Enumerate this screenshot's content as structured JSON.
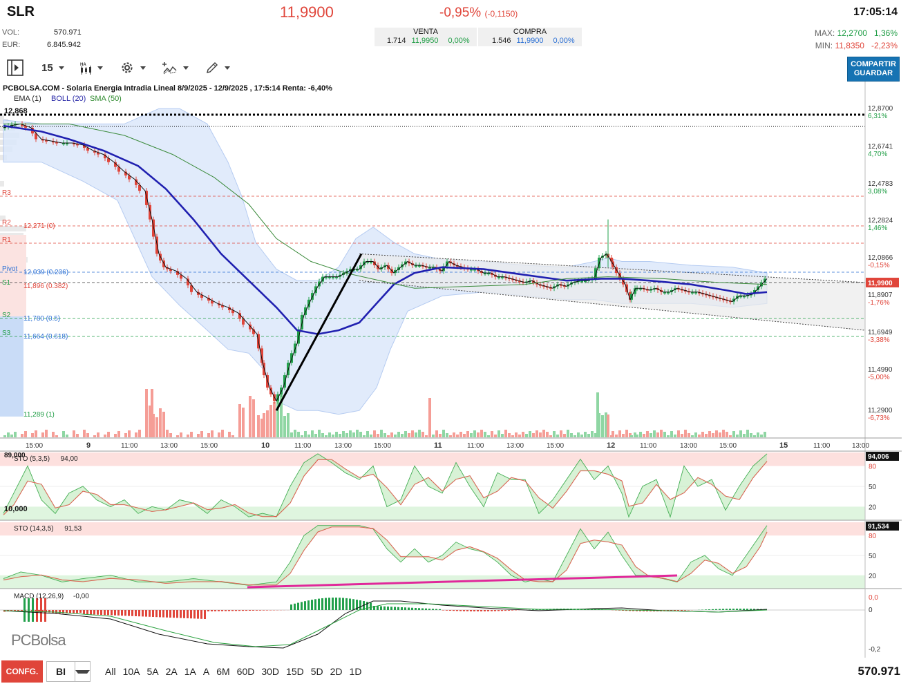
{
  "header": {
    "ticker": "SLR",
    "price": "11,9900",
    "change": "-0,95%",
    "change_abs": "(-0,1150)",
    "time": "17:05:14",
    "vol_label": "VOL:",
    "vol_value": "570.971",
    "eur_label": "EUR:",
    "eur_value": "6.845.942",
    "venta": {
      "title": "VENTA",
      "qty": "1.714",
      "price": "11,9950",
      "pct": "0,00%"
    },
    "compra": {
      "title": "COMPRA",
      "qty": "1.546",
      "price": "11,9900",
      "pct": "0,00%"
    },
    "max_label": "MAX:",
    "max_value": "12,2700",
    "max_pct": "1,36%",
    "min_label": "MIN:",
    "min_value": "11,8350",
    "min_pct": "-2,23%"
  },
  "toolbar": {
    "interval": "15",
    "candle_icon_label": "HA",
    "share_line1": "COMPARTIR",
    "share_line2": "GUARDAR"
  },
  "chart": {
    "title": "PCBOLSA.COM - Solaria Energia Intradia Lineal 8/9/2025 - 12/9/2025 , 17:5:14 Renta: -6,40%",
    "legend": {
      "ema": "EMA (1)",
      "boll": "BOLL (20)",
      "sma": "SMA (50)"
    },
    "colors": {
      "up": "#22a04b",
      "down": "#e0453a",
      "ema": "#2020b0",
      "sma": "#3a8a3a",
      "boll_fill": "#dce8fb",
      "pink": "#e0289a"
    },
    "top_label": "12,868",
    "last_price_tag": "11,9900",
    "price_axis": [
      {
        "v": "12,8700",
        "p": "6,31%"
      },
      {
        "v": "12,6741",
        "p": "4,70%"
      },
      {
        "v": "12,4783",
        "p": "3,08%"
      },
      {
        "v": "12,2824",
        "p": "1,46%"
      },
      {
        "v": "12,0866",
        "p": "-0,15%"
      },
      {
        "v": "11,8907",
        "p": "-1,76%"
      },
      {
        "v": "11,6949",
        "p": "-3,38%"
      },
      {
        "v": "11,4990",
        "p": "-5,00%"
      },
      {
        "v": "11,2900",
        "p": "-6,73%"
      }
    ],
    "pivots": [
      {
        "name": "R3",
        "val": ""
      },
      {
        "name": "R2",
        "val": "12,271 (0)"
      },
      {
        "name": "R1",
        "val": ""
      },
      {
        "name": "Pivot",
        "val": "12,039 (0.236)"
      },
      {
        "name": "S1",
        "val": "11,896 (0.382)"
      },
      {
        "name": "S2",
        "val": "11,780 (0.5)"
      },
      {
        "name": "S3",
        "val": "11,664 (0.618)"
      },
      {
        "name": "",
        "val": "11,289 (1)"
      }
    ],
    "time_axis": [
      "15:00",
      "9",
      "11:00",
      "13:00",
      "15:00",
      "10",
      "11:00",
      "13:00",
      "15:00",
      "11",
      "11:00",
      "13:00",
      "15:00",
      "12",
      "11:00",
      "13:00",
      "15:00",
      "15",
      "11:00",
      "13:00"
    ],
    "vol_max_label": "89,000",
    "vol_min_label": "10,000"
  },
  "sto1": {
    "label": "STO (5,3,5)",
    "value": "94,00",
    "tag": "94,006",
    "levels": [
      "80",
      "50",
      "20"
    ]
  },
  "sto2": {
    "label": "STO (14,3,5)",
    "value": "91,53",
    "tag": "91,534",
    "levels": [
      "80",
      "50",
      "20"
    ]
  },
  "macd": {
    "label": "MACD (12,26,9)",
    "value": "-0,00",
    "levels": [
      "0,0",
      "0",
      "-0,2"
    ]
  },
  "logo": "PCBolsa",
  "bottom": {
    "config": "CONFG.",
    "mode": "BI",
    "ranges": [
      "All",
      "10A",
      "5A",
      "2A",
      "1A",
      "A",
      "6M",
      "60D",
      "30D",
      "15D",
      "5D",
      "2D",
      "1D"
    ],
    "volume": "570.971"
  }
}
